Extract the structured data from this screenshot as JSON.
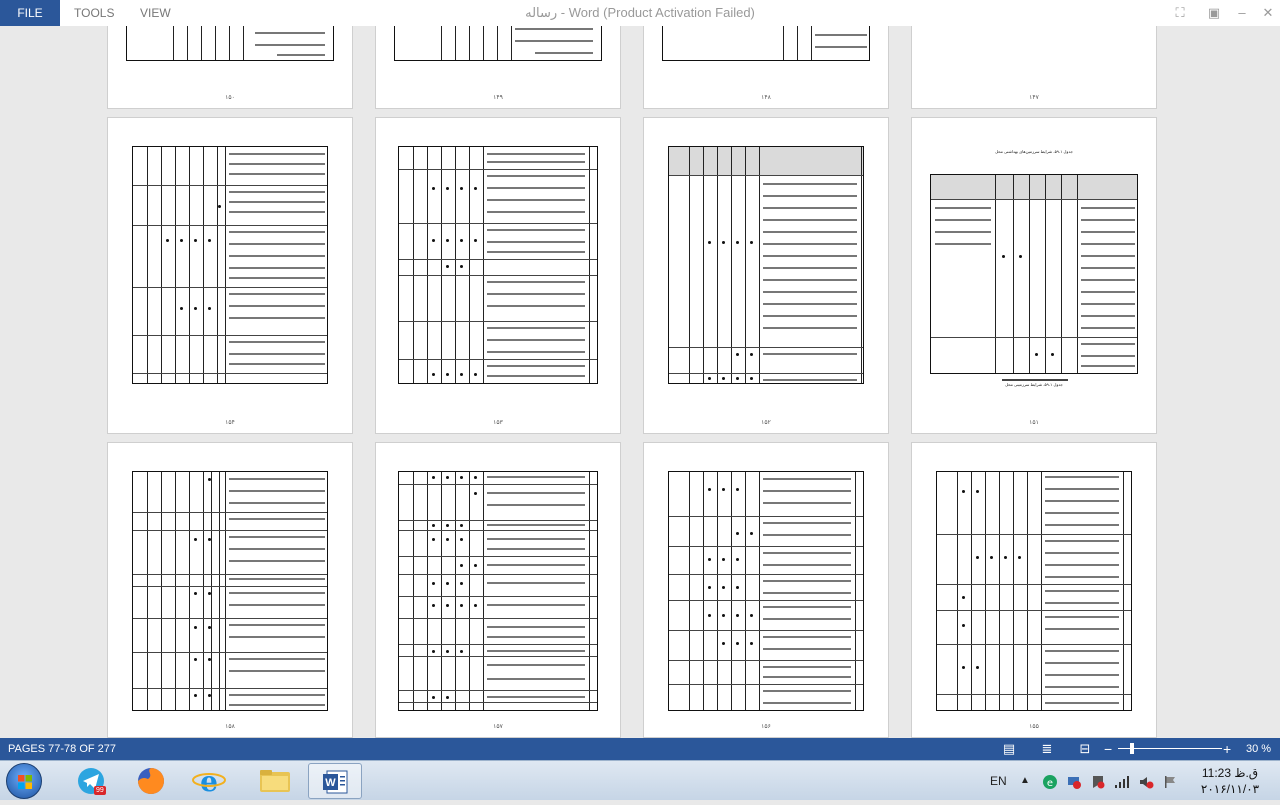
{
  "menu": {
    "file": "FILE",
    "tools": "TOOLS",
    "view": "VIEW"
  },
  "window": {
    "title": "رساله - Word (Product Activation Failed)"
  },
  "pages": [
    {
      "number": "۱۵۰"
    },
    {
      "number": "۱۴۹"
    },
    {
      "number": "۱۴۸"
    },
    {
      "number": "۱۴۷"
    },
    {
      "number": "۱۵۴"
    },
    {
      "number": "۱۵۳"
    },
    {
      "number": "۱۵۲"
    },
    {
      "number": "۱۵۱"
    },
    {
      "number": "۱۵۸"
    },
    {
      "number": "۱۵۷"
    },
    {
      "number": "۱۵۶"
    },
    {
      "number": "۱۵۵"
    }
  ],
  "page151": {
    "title": "جدول ۱-۵۹- شرایط سرزمین‌های بهداشتی محل",
    "caption": "جدول ۱-۵۹- شرایط سرزمینی محل"
  },
  "statusbar": {
    "pages": "PAGES 77-78 OF 277",
    "zoom_minus": "−",
    "zoom_plus": "+",
    "zoom": "30 %"
  },
  "taskbar": {
    "lang": "EN",
    "badge": "99",
    "time": "11:23 ق.ظ",
    "date": "۲۰۱۶/۱۱/۰۳"
  },
  "colors": {
    "accent": "#2b579a",
    "page": "#ffffff",
    "canvas": "#e9e9e9"
  }
}
